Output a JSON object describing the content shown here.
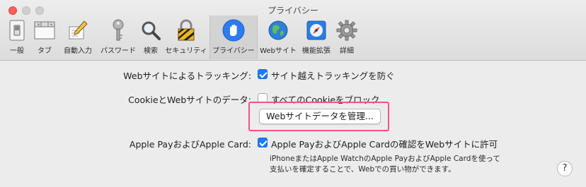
{
  "window": {
    "title": "プライバシー"
  },
  "toolbar": {
    "tabs": [
      {
        "label": "一般",
        "icon": "general-switch-icon"
      },
      {
        "label": "タブ",
        "icon": "tabs-icon"
      },
      {
        "label": "自動入力",
        "icon": "autofill-pencil-icon"
      },
      {
        "label": "パスワード",
        "icon": "key-icon"
      },
      {
        "label": "検索",
        "icon": "magnifier-icon"
      },
      {
        "label": "セキュリティ",
        "icon": "padlock-icon"
      },
      {
        "label": "プライバシー",
        "icon": "hand-icon",
        "active": true
      },
      {
        "label": "Webサイト",
        "icon": "globe-icon"
      },
      {
        "label": "機能拡張",
        "icon": "puzzle-compass-icon"
      },
      {
        "label": "詳細",
        "icon": "gear-icon"
      }
    ]
  },
  "tracking": {
    "label": "Webサイトによるトラッキング:",
    "checkbox_text": "サイト越えトラッキングを防ぐ",
    "checked": true
  },
  "cookies": {
    "label": "CookieとWebサイトのデータ:",
    "checkbox_text": "すべてのCookieをブロック",
    "checked": false,
    "manage_button": "Webサイトデータを管理..."
  },
  "applepay": {
    "label": "Apple PayおよびApple Card:",
    "checkbox_text": "Apple PayおよびApple Cardの確認をWebサイトに許可",
    "checked": true,
    "note_line1": "iPhoneまたはApple WatchのApple PayおよびApple Cardを使って",
    "note_line2": "支払いを確定することで、Webでの買い物ができます。"
  },
  "help": {
    "label": "?"
  },
  "colors": {
    "accent": "#1b7cf4",
    "highlight": "#f0538a"
  }
}
